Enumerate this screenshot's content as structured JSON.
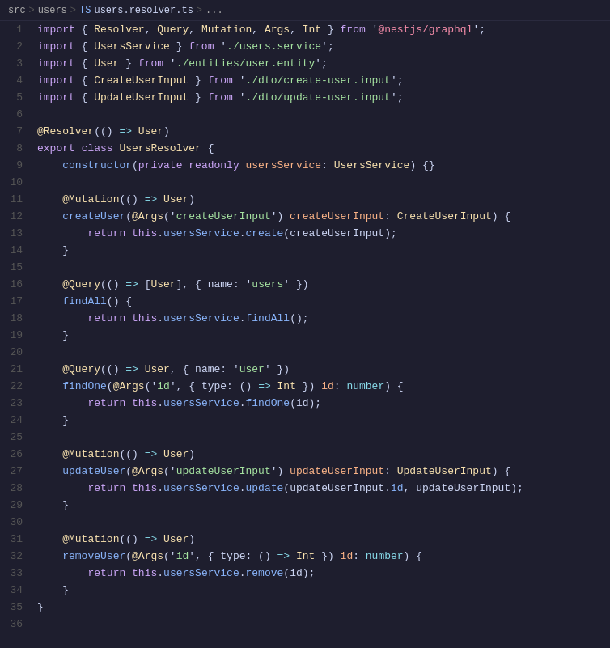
{
  "breadcrumb": {
    "src": "src",
    "sep1": ">",
    "users": "users",
    "sep2": ">",
    "ts": "TS",
    "filename": "users.resolver.ts",
    "sep3": ">",
    "ellipsis": "..."
  },
  "lines": [
    {
      "num": 1,
      "tokens": [
        {
          "t": "kw",
          "v": "import"
        },
        {
          "t": "punc",
          "v": " { "
        },
        {
          "t": "cls",
          "v": "Resolver"
        },
        {
          "t": "punc",
          "v": ", "
        },
        {
          "t": "cls",
          "v": "Query"
        },
        {
          "t": "punc",
          "v": ", "
        },
        {
          "t": "cls",
          "v": "Mutation"
        },
        {
          "t": "punc",
          "v": ", "
        },
        {
          "t": "cls",
          "v": "Args"
        },
        {
          "t": "punc",
          "v": ", "
        },
        {
          "t": "cls",
          "v": "Int"
        },
        {
          "t": "punc",
          "v": " } "
        },
        {
          "t": "kw",
          "v": "from"
        },
        {
          "t": "punc",
          "v": " '"
        },
        {
          "t": "str2",
          "v": "@nestjs/graphql"
        },
        {
          "t": "punc",
          "v": "';"
        }
      ]
    },
    {
      "num": 2,
      "tokens": [
        {
          "t": "kw",
          "v": "import"
        },
        {
          "t": "punc",
          "v": " { "
        },
        {
          "t": "cls",
          "v": "UsersService"
        },
        {
          "t": "punc",
          "v": " } "
        },
        {
          "t": "kw",
          "v": "from"
        },
        {
          "t": "punc",
          "v": " '"
        },
        {
          "t": "str",
          "v": "./users.service"
        },
        {
          "t": "punc",
          "v": "';"
        }
      ]
    },
    {
      "num": 3,
      "tokens": [
        {
          "t": "kw",
          "v": "import"
        },
        {
          "t": "punc",
          "v": " { "
        },
        {
          "t": "cls",
          "v": "User"
        },
        {
          "t": "punc",
          "v": " } "
        },
        {
          "t": "kw",
          "v": "from"
        },
        {
          "t": "punc",
          "v": " '"
        },
        {
          "t": "str",
          "v": "./entities/user.entity"
        },
        {
          "t": "punc",
          "v": "';"
        }
      ]
    },
    {
      "num": 4,
      "tokens": [
        {
          "t": "kw",
          "v": "import"
        },
        {
          "t": "punc",
          "v": " { "
        },
        {
          "t": "cls",
          "v": "CreateUserInput"
        },
        {
          "t": "punc",
          "v": " } "
        },
        {
          "t": "kw",
          "v": "from"
        },
        {
          "t": "punc",
          "v": " '"
        },
        {
          "t": "str",
          "v": "./dto/create-user.input"
        },
        {
          "t": "punc",
          "v": "';"
        }
      ]
    },
    {
      "num": 5,
      "tokens": [
        {
          "t": "kw",
          "v": "import"
        },
        {
          "t": "punc",
          "v": " { "
        },
        {
          "t": "cls",
          "v": "UpdateUserInput"
        },
        {
          "t": "punc",
          "v": " } "
        },
        {
          "t": "kw",
          "v": "from"
        },
        {
          "t": "punc",
          "v": " '"
        },
        {
          "t": "str",
          "v": "./dto/update-user.input"
        },
        {
          "t": "punc",
          "v": "';"
        }
      ]
    },
    {
      "num": 6,
      "tokens": []
    },
    {
      "num": 7,
      "tokens": [
        {
          "t": "dec",
          "v": "@Resolver"
        },
        {
          "t": "punc",
          "v": "(()"
        },
        {
          "t": "op",
          "v": " => "
        },
        {
          "t": "cls",
          "v": "User"
        },
        {
          "t": "punc",
          "v": ")"
        }
      ]
    },
    {
      "num": 8,
      "tokens": [
        {
          "t": "kw",
          "v": "export"
        },
        {
          "t": "punc",
          "v": " "
        },
        {
          "t": "kw",
          "v": "class"
        },
        {
          "t": "punc",
          "v": " "
        },
        {
          "t": "cls",
          "v": "UsersResolver"
        },
        {
          "t": "punc",
          "v": " {"
        }
      ]
    },
    {
      "num": 9,
      "tokens": [
        {
          "t": "punc",
          "v": "    "
        },
        {
          "t": "fn",
          "v": "constructor"
        },
        {
          "t": "punc",
          "v": "("
        },
        {
          "t": "kw",
          "v": "private"
        },
        {
          "t": "punc",
          "v": " "
        },
        {
          "t": "kw",
          "v": "readonly"
        },
        {
          "t": "punc",
          "v": " "
        },
        {
          "t": "param",
          "v": "usersService"
        },
        {
          "t": "punc",
          "v": ": "
        },
        {
          "t": "cls",
          "v": "UsersService"
        },
        {
          "t": "punc",
          "v": ") {}"
        }
      ]
    },
    {
      "num": 10,
      "tokens": []
    },
    {
      "num": 11,
      "tokens": [
        {
          "t": "punc",
          "v": "    "
        },
        {
          "t": "dec",
          "v": "@Mutation"
        },
        {
          "t": "punc",
          "v": "(()"
        },
        {
          "t": "op",
          "v": " => "
        },
        {
          "t": "cls",
          "v": "User"
        },
        {
          "t": "punc",
          "v": ")"
        }
      ]
    },
    {
      "num": 12,
      "tokens": [
        {
          "t": "punc",
          "v": "    "
        },
        {
          "t": "fn",
          "v": "createUser"
        },
        {
          "t": "punc",
          "v": "("
        },
        {
          "t": "dec",
          "v": "@Args"
        },
        {
          "t": "punc",
          "v": "('"
        },
        {
          "t": "str",
          "v": "createUserInput"
        },
        {
          "t": "punc",
          "v": "') "
        },
        {
          "t": "param",
          "v": "createUserInput"
        },
        {
          "t": "punc",
          "v": ": "
        },
        {
          "t": "cls",
          "v": "CreateUserInput"
        },
        {
          "t": "punc",
          "v": ") {"
        }
      ]
    },
    {
      "num": 13,
      "tokens": [
        {
          "t": "punc",
          "v": "        "
        },
        {
          "t": "kw",
          "v": "return"
        },
        {
          "t": "punc",
          "v": " "
        },
        {
          "t": "kw",
          "v": "this"
        },
        {
          "t": "punc",
          "v": "."
        },
        {
          "t": "prop",
          "v": "usersService"
        },
        {
          "t": "punc",
          "v": "."
        },
        {
          "t": "fn",
          "v": "create"
        },
        {
          "t": "punc",
          "v": "("
        },
        {
          "t": "var",
          "v": "createUserInput"
        },
        {
          "t": "punc",
          "v": ");"
        }
      ]
    },
    {
      "num": 14,
      "tokens": [
        {
          "t": "punc",
          "v": "    }"
        }
      ]
    },
    {
      "num": 15,
      "tokens": []
    },
    {
      "num": 16,
      "tokens": [
        {
          "t": "punc",
          "v": "    "
        },
        {
          "t": "dec",
          "v": "@Query"
        },
        {
          "t": "punc",
          "v": "(()"
        },
        {
          "t": "op",
          "v": " => "
        },
        {
          "t": "punc",
          "v": "["
        },
        {
          "t": "cls",
          "v": "User"
        },
        {
          "t": "punc",
          "v": "], { "
        },
        {
          "t": "var",
          "v": "name"
        },
        {
          "t": "punc",
          "v": ": '"
        },
        {
          "t": "name-str",
          "v": "users"
        },
        {
          "t": "punc",
          "v": "' })"
        }
      ]
    },
    {
      "num": 17,
      "tokens": [
        {
          "t": "punc",
          "v": "    "
        },
        {
          "t": "fn",
          "v": "findAll"
        },
        {
          "t": "punc",
          "v": "() {"
        }
      ]
    },
    {
      "num": 18,
      "tokens": [
        {
          "t": "punc",
          "v": "        "
        },
        {
          "t": "kw",
          "v": "return"
        },
        {
          "t": "punc",
          "v": " "
        },
        {
          "t": "kw",
          "v": "this"
        },
        {
          "t": "punc",
          "v": "."
        },
        {
          "t": "prop",
          "v": "usersService"
        },
        {
          "t": "punc",
          "v": "."
        },
        {
          "t": "fn",
          "v": "findAll"
        },
        {
          "t": "punc",
          "v": "();"
        }
      ]
    },
    {
      "num": 19,
      "tokens": [
        {
          "t": "punc",
          "v": "    }"
        }
      ]
    },
    {
      "num": 20,
      "tokens": []
    },
    {
      "num": 21,
      "tokens": [
        {
          "t": "punc",
          "v": "    "
        },
        {
          "t": "dec",
          "v": "@Query"
        },
        {
          "t": "punc",
          "v": "(()"
        },
        {
          "t": "op",
          "v": " => "
        },
        {
          "t": "cls",
          "v": "User"
        },
        {
          "t": "punc",
          "v": ", { "
        },
        {
          "t": "var",
          "v": "name"
        },
        {
          "t": "punc",
          "v": ": '"
        },
        {
          "t": "name-str",
          "v": "user"
        },
        {
          "t": "punc",
          "v": "' })"
        }
      ]
    },
    {
      "num": 22,
      "tokens": [
        {
          "t": "punc",
          "v": "    "
        },
        {
          "t": "fn",
          "v": "findOne"
        },
        {
          "t": "punc",
          "v": "("
        },
        {
          "t": "dec",
          "v": "@Args"
        },
        {
          "t": "punc",
          "v": "('"
        },
        {
          "t": "str",
          "v": "id"
        },
        {
          "t": "punc",
          "v": "', { "
        },
        {
          "t": "var",
          "v": "type"
        },
        {
          "t": "punc",
          "v": ": ()"
        },
        {
          "t": "op",
          "v": " => "
        },
        {
          "t": "cls",
          "v": "Int"
        },
        {
          "t": "punc",
          "v": " }) "
        },
        {
          "t": "param",
          "v": "id"
        },
        {
          "t": "punc",
          "v": ": "
        },
        {
          "t": "kw2",
          "v": "number"
        },
        {
          "t": "punc",
          "v": ") {"
        }
      ]
    },
    {
      "num": 23,
      "tokens": [
        {
          "t": "punc",
          "v": "        "
        },
        {
          "t": "kw",
          "v": "return"
        },
        {
          "t": "punc",
          "v": " "
        },
        {
          "t": "kw",
          "v": "this"
        },
        {
          "t": "punc",
          "v": "."
        },
        {
          "t": "prop",
          "v": "usersService"
        },
        {
          "t": "punc",
          "v": "."
        },
        {
          "t": "fn",
          "v": "findOne"
        },
        {
          "t": "punc",
          "v": "("
        },
        {
          "t": "var",
          "v": "id"
        },
        {
          "t": "punc",
          "v": ");"
        }
      ]
    },
    {
      "num": 24,
      "tokens": [
        {
          "t": "punc",
          "v": "    }"
        }
      ]
    },
    {
      "num": 25,
      "tokens": []
    },
    {
      "num": 26,
      "tokens": [
        {
          "t": "punc",
          "v": "    "
        },
        {
          "t": "dec",
          "v": "@Mutation"
        },
        {
          "t": "punc",
          "v": "(()"
        },
        {
          "t": "op",
          "v": " => "
        },
        {
          "t": "cls",
          "v": "User"
        },
        {
          "t": "punc",
          "v": ")"
        }
      ]
    },
    {
      "num": 27,
      "tokens": [
        {
          "t": "punc",
          "v": "    "
        },
        {
          "t": "fn",
          "v": "updateUser"
        },
        {
          "t": "punc",
          "v": "("
        },
        {
          "t": "dec",
          "v": "@Args"
        },
        {
          "t": "punc",
          "v": "('"
        },
        {
          "t": "str",
          "v": "updateUserInput"
        },
        {
          "t": "punc",
          "v": "') "
        },
        {
          "t": "param",
          "v": "updateUserInput"
        },
        {
          "t": "punc",
          "v": ": "
        },
        {
          "t": "cls",
          "v": "UpdateUserInput"
        },
        {
          "t": "punc",
          "v": ") {"
        }
      ]
    },
    {
      "num": 28,
      "tokens": [
        {
          "t": "punc",
          "v": "        "
        },
        {
          "t": "kw",
          "v": "return"
        },
        {
          "t": "punc",
          "v": " "
        },
        {
          "t": "kw",
          "v": "this"
        },
        {
          "t": "punc",
          "v": "."
        },
        {
          "t": "prop",
          "v": "usersService"
        },
        {
          "t": "punc",
          "v": "."
        },
        {
          "t": "fn",
          "v": "update"
        },
        {
          "t": "punc",
          "v": "("
        },
        {
          "t": "var",
          "v": "updateUserInput"
        },
        {
          "t": "punc",
          "v": "."
        },
        {
          "t": "prop",
          "v": "id"
        },
        {
          "t": "punc",
          "v": ", "
        },
        {
          "t": "var",
          "v": "updateUserInput"
        },
        {
          "t": "punc",
          "v": ");"
        }
      ]
    },
    {
      "num": 29,
      "tokens": [
        {
          "t": "punc",
          "v": "    }"
        }
      ]
    },
    {
      "num": 30,
      "tokens": []
    },
    {
      "num": 31,
      "tokens": [
        {
          "t": "punc",
          "v": "    "
        },
        {
          "t": "dec",
          "v": "@Mutation"
        },
        {
          "t": "punc",
          "v": "(()"
        },
        {
          "t": "op",
          "v": " => "
        },
        {
          "t": "cls",
          "v": "User"
        },
        {
          "t": "punc",
          "v": ")"
        }
      ]
    },
    {
      "num": 32,
      "tokens": [
        {
          "t": "punc",
          "v": "    "
        },
        {
          "t": "fn",
          "v": "removeUser"
        },
        {
          "t": "punc",
          "v": "("
        },
        {
          "t": "dec",
          "v": "@Args"
        },
        {
          "t": "punc",
          "v": "('"
        },
        {
          "t": "str",
          "v": "id"
        },
        {
          "t": "punc",
          "v": "', { "
        },
        {
          "t": "var",
          "v": "type"
        },
        {
          "t": "punc",
          "v": ": ()"
        },
        {
          "t": "op",
          "v": " => "
        },
        {
          "t": "cls",
          "v": "Int"
        },
        {
          "t": "punc",
          "v": " }) "
        },
        {
          "t": "param",
          "v": "id"
        },
        {
          "t": "punc",
          "v": ": "
        },
        {
          "t": "kw2",
          "v": "number"
        },
        {
          "t": "punc",
          "v": ") {"
        }
      ]
    },
    {
      "num": 33,
      "tokens": [
        {
          "t": "punc",
          "v": "        "
        },
        {
          "t": "kw",
          "v": "return"
        },
        {
          "t": "punc",
          "v": " "
        },
        {
          "t": "kw",
          "v": "this"
        },
        {
          "t": "punc",
          "v": "."
        },
        {
          "t": "prop",
          "v": "usersService"
        },
        {
          "t": "punc",
          "v": "."
        },
        {
          "t": "fn",
          "v": "remove"
        },
        {
          "t": "punc",
          "v": "("
        },
        {
          "t": "var",
          "v": "id"
        },
        {
          "t": "punc",
          "v": ");"
        }
      ]
    },
    {
      "num": 34,
      "tokens": [
        {
          "t": "punc",
          "v": "    }"
        }
      ]
    },
    {
      "num": 35,
      "tokens": [
        {
          "t": "punc",
          "v": "}"
        }
      ]
    },
    {
      "num": 36,
      "tokens": []
    }
  ]
}
